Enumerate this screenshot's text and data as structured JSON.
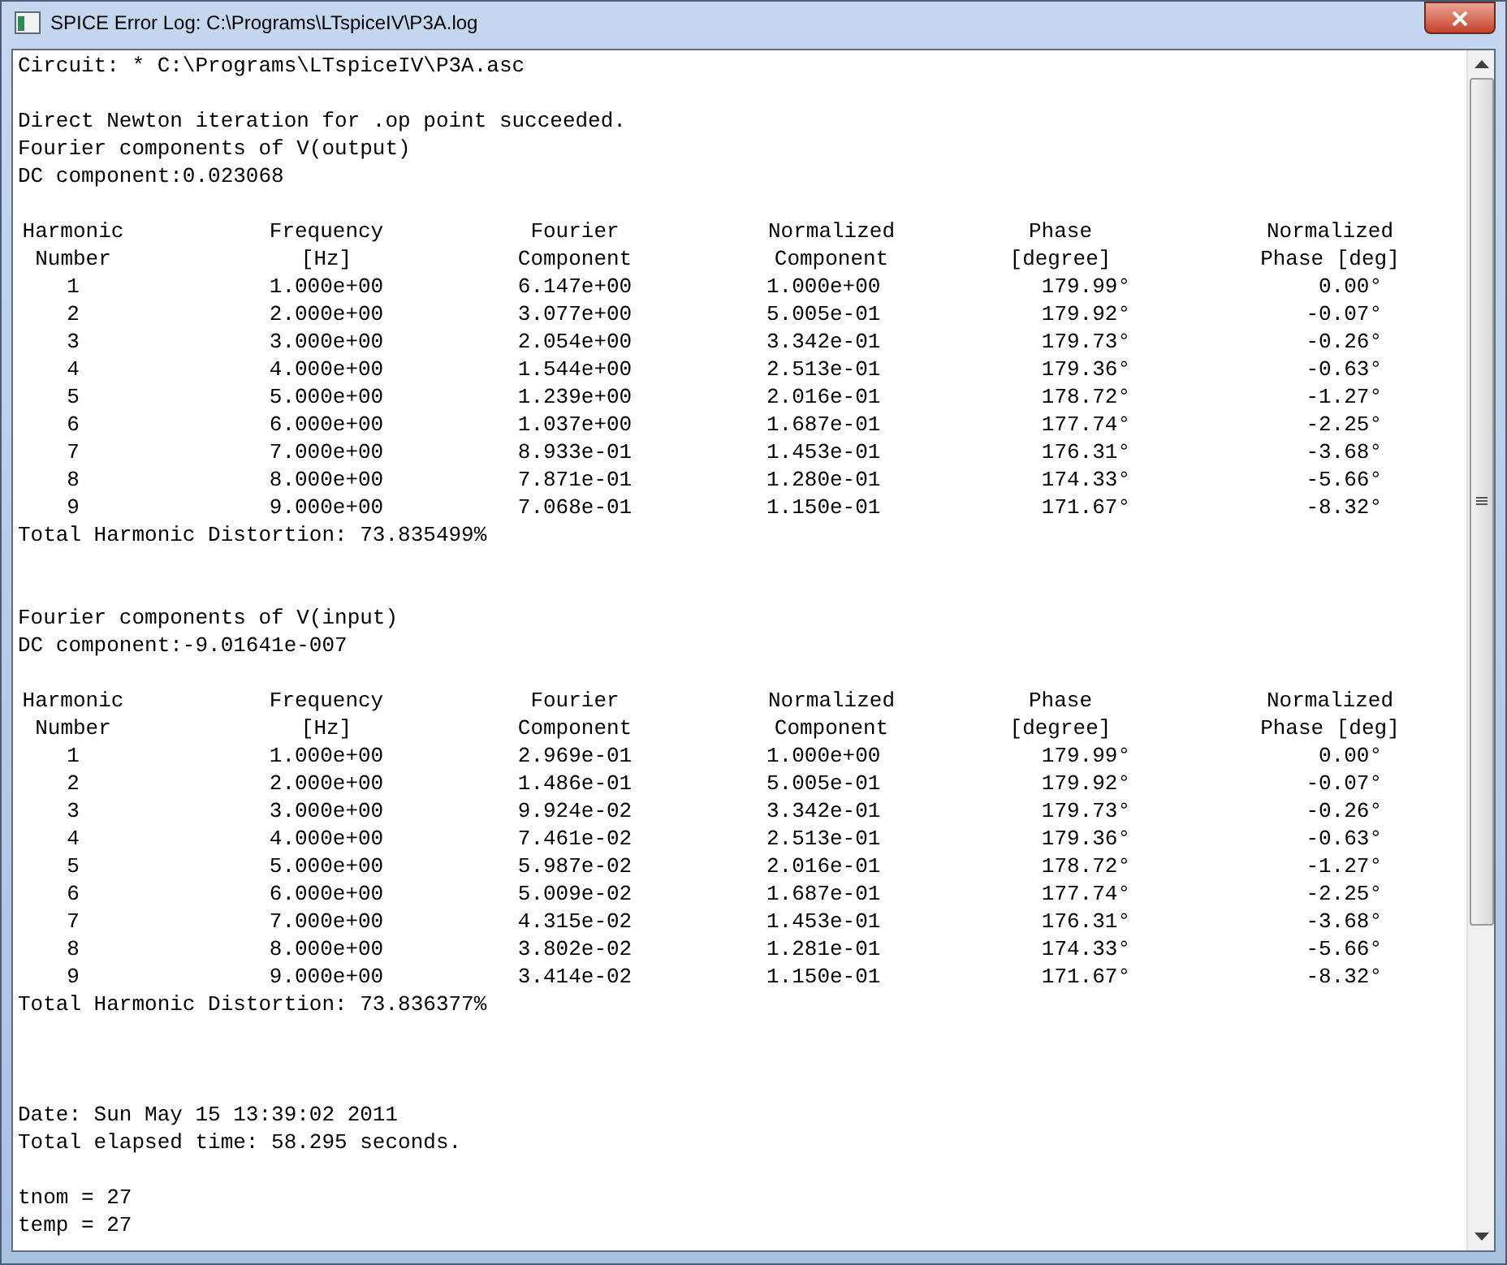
{
  "window": {
    "title": "SPICE Error Log: C:\\Programs\\LTspiceIV\\P3A.log"
  },
  "log": [
    {
      "kind": "line",
      "text": "Circuit: * C:\\Programs\\LTspiceIV\\P3A.asc"
    },
    {
      "kind": "blank"
    },
    {
      "kind": "line",
      "text": "Direct Newton iteration for .op point succeeded."
    },
    {
      "kind": "line",
      "text": "Fourier components of V(output)"
    },
    {
      "kind": "line",
      "text": "DC component:0.023068"
    },
    {
      "kind": "blank"
    },
    {
      "kind": "table",
      "header_rows": [
        [
          "Harmonic",
          "Frequency",
          "Fourier",
          "Normalized",
          "Phase",
          "Normalized"
        ],
        [
          "Number",
          "[Hz]",
          "Component",
          "Component",
          "[degree]",
          "Phase [deg]"
        ]
      ],
      "rows": [
        [
          "1",
          "1.000e+00",
          "6.147e+00",
          "1.000e+00",
          "179.99°",
          "0.00°"
        ],
        [
          "2",
          "2.000e+00",
          "3.077e+00",
          "5.005e-01",
          "179.92°",
          "-0.07°"
        ],
        [
          "3",
          "3.000e+00",
          "2.054e+00",
          "3.342e-01",
          "179.73°",
          "-0.26°"
        ],
        [
          "4",
          "4.000e+00",
          "1.544e+00",
          "2.513e-01",
          "179.36°",
          "-0.63°"
        ],
        [
          "5",
          "5.000e+00",
          "1.239e+00",
          "2.016e-01",
          "178.72°",
          "-1.27°"
        ],
        [
          "6",
          "6.000e+00",
          "1.037e+00",
          "1.687e-01",
          "177.74°",
          "-2.25°"
        ],
        [
          "7",
          "7.000e+00",
          "8.933e-01",
          "1.453e-01",
          "176.31°",
          "-3.68°"
        ],
        [
          "8",
          "8.000e+00",
          "7.871e-01",
          "1.280e-01",
          "174.33°",
          "-5.66°"
        ],
        [
          "9",
          "9.000e+00",
          "7.068e-01",
          "1.150e-01",
          "171.67°",
          "-8.32°"
        ]
      ]
    },
    {
      "kind": "line",
      "text": "Total Harmonic Distortion: 73.835499%"
    },
    {
      "kind": "blank"
    },
    {
      "kind": "blank"
    },
    {
      "kind": "line",
      "text": "Fourier components of V(input)"
    },
    {
      "kind": "line",
      "text": "DC component:-9.01641e-007"
    },
    {
      "kind": "blank"
    },
    {
      "kind": "table",
      "header_rows": [
        [
          "Harmonic",
          "Frequency",
          "Fourier",
          "Normalized",
          "Phase",
          "Normalized"
        ],
        [
          "Number",
          "[Hz]",
          "Component",
          "Component",
          "[degree]",
          "Phase [deg]"
        ]
      ],
      "rows": [
        [
          "1",
          "1.000e+00",
          "2.969e-01",
          "1.000e+00",
          "179.99°",
          "0.00°"
        ],
        [
          "2",
          "2.000e+00",
          "1.486e-01",
          "5.005e-01",
          "179.92°",
          "-0.07°"
        ],
        [
          "3",
          "3.000e+00",
          "9.924e-02",
          "3.342e-01",
          "179.73°",
          "-0.26°"
        ],
        [
          "4",
          "4.000e+00",
          "7.461e-02",
          "2.513e-01",
          "179.36°",
          "-0.63°"
        ],
        [
          "5",
          "5.000e+00",
          "5.987e-02",
          "2.016e-01",
          "178.72°",
          "-1.27°"
        ],
        [
          "6",
          "6.000e+00",
          "5.009e-02",
          "1.687e-01",
          "177.74°",
          "-2.25°"
        ],
        [
          "7",
          "7.000e+00",
          "4.315e-02",
          "1.453e-01",
          "176.31°",
          "-3.68°"
        ],
        [
          "8",
          "8.000e+00",
          "3.802e-02",
          "1.281e-01",
          "174.33°",
          "-5.66°"
        ],
        [
          "9",
          "9.000e+00",
          "3.414e-02",
          "1.150e-01",
          "171.67°",
          "-8.32°"
        ]
      ]
    },
    {
      "kind": "line",
      "text": "Total Harmonic Distortion: 73.836377%"
    },
    {
      "kind": "blank"
    },
    {
      "kind": "blank"
    },
    {
      "kind": "blank"
    },
    {
      "kind": "line",
      "text": "Date: Sun May 15 13:39:02 2011"
    },
    {
      "kind": "line",
      "text": "Total elapsed time: 58.295 seconds."
    },
    {
      "kind": "blank"
    },
    {
      "kind": "line",
      "text": "tnom = 27"
    },
    {
      "kind": "line",
      "text": "temp = 27"
    }
  ]
}
